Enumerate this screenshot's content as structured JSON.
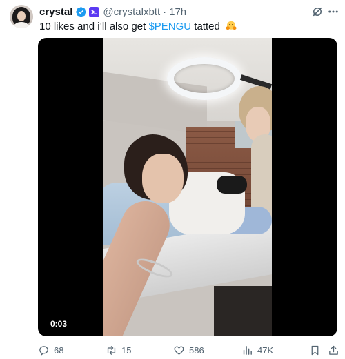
{
  "author": {
    "display_name": "crystal",
    "handle": "@crystalxbtt",
    "separator": "·",
    "timestamp": "17h"
  },
  "tweet": {
    "text_before": "10 likes and i’ll also get ",
    "cashtag": "$PENGU",
    "text_after": " tatted"
  },
  "video": {
    "duration": "0:03"
  },
  "actions": {
    "replies": "68",
    "reposts": "15",
    "likes": "586",
    "views": "47K"
  },
  "colors": {
    "link": "#1d9bf0",
    "secondary_text": "#536471",
    "verified": "#1d9bf0",
    "affiliate": "#5b3bf2"
  },
  "icons": [
    "verified-badge-icon",
    "affiliate-badge-icon",
    "grok-icon",
    "more-icon",
    "hugging-face-emoji",
    "reply-icon",
    "repost-icon",
    "like-icon",
    "views-icon",
    "bookmark-icon",
    "share-icon"
  ]
}
